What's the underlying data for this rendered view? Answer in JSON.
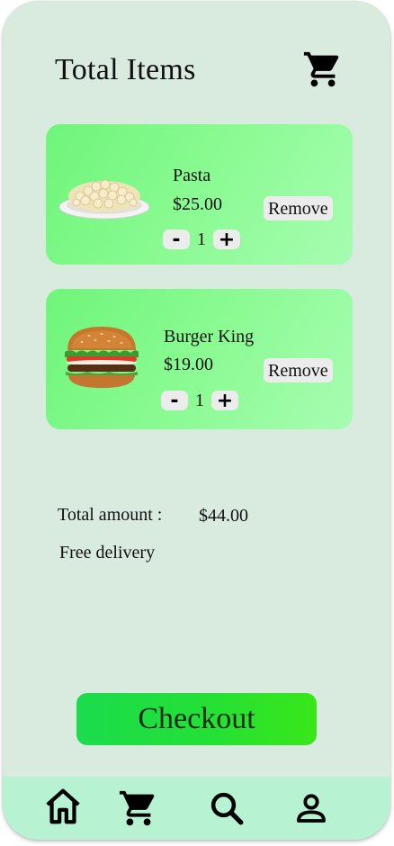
{
  "header": {
    "title": "Total Items",
    "cart_icon": "cart-icon"
  },
  "cart_items": [
    {
      "name": "Pasta",
      "price": "$25.00",
      "quantity": "1",
      "remove_label": "Remove",
      "decrement": "-",
      "increment": "+"
    },
    {
      "name": "Burger King",
      "price": "$19.00",
      "quantity": "1",
      "remove_label": "Remove",
      "decrement": "-",
      "increment": "+"
    }
  ],
  "summary": {
    "total_label": "Total amount :",
    "total_value": "$44.00",
    "delivery": "Free delivery"
  },
  "checkout": {
    "label": "Checkout"
  },
  "bottom_nav": {
    "items": [
      "home-icon",
      "cart-icon",
      "search-icon",
      "profile-icon"
    ]
  },
  "colors": {
    "background": "#d9eadf",
    "card": "#8dfb95",
    "checkout": "#22e038",
    "navbar": "#b7f3d2"
  }
}
